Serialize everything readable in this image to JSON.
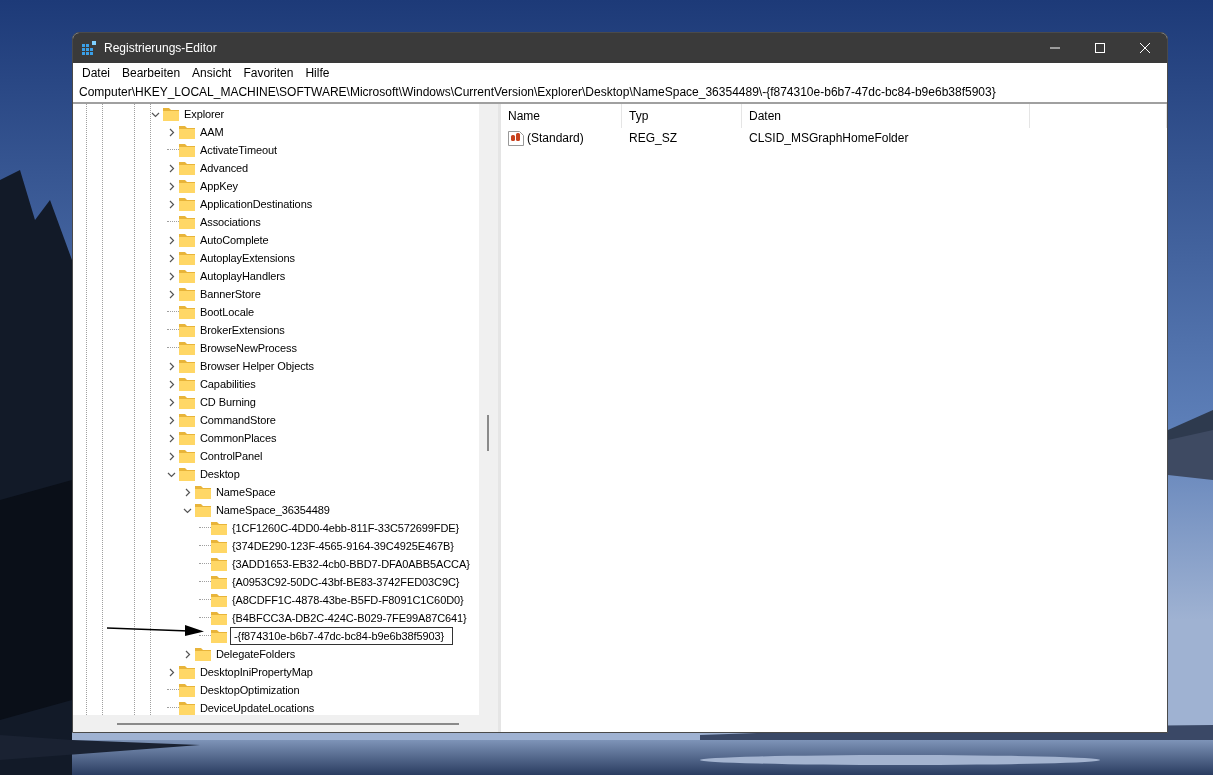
{
  "window": {
    "title": "Registrierungs-Editor"
  },
  "menu": [
    "Datei",
    "Bearbeiten",
    "Ansicht",
    "Favoriten",
    "Hilfe"
  ],
  "address": "Computer\\HKEY_LOCAL_MACHINE\\SOFTWARE\\Microsoft\\Windows\\CurrentVersion\\Explorer\\Desktop\\NameSpace_36354489\\-{f874310e-b6b7-47dc-bc84-b9e6b38f5903}",
  "tree": [
    {
      "label": "Explorer",
      "kind": "expanded",
      "editing": false,
      "children": [
        {
          "label": "AAM",
          "kind": "collapsed",
          "editing": false
        },
        {
          "label": "ActivateTimeout",
          "kind": "leaf",
          "editing": false
        },
        {
          "label": "Advanced",
          "kind": "collapsed",
          "editing": false
        },
        {
          "label": "AppKey",
          "kind": "collapsed",
          "editing": false
        },
        {
          "label": "ApplicationDestinations",
          "kind": "collapsed",
          "editing": false
        },
        {
          "label": "Associations",
          "kind": "leaf",
          "editing": false
        },
        {
          "label": "AutoComplete",
          "kind": "collapsed",
          "editing": false
        },
        {
          "label": "AutoplayExtensions",
          "kind": "collapsed",
          "editing": false
        },
        {
          "label": "AutoplayHandlers",
          "kind": "collapsed",
          "editing": false
        },
        {
          "label": "BannerStore",
          "kind": "collapsed",
          "editing": false
        },
        {
          "label": "BootLocale",
          "kind": "leaf",
          "editing": false
        },
        {
          "label": "BrokerExtensions",
          "kind": "leaf",
          "editing": false
        },
        {
          "label": "BrowseNewProcess",
          "kind": "leaf",
          "editing": false
        },
        {
          "label": "Browser Helper Objects",
          "kind": "collapsed",
          "editing": false
        },
        {
          "label": "Capabilities",
          "kind": "collapsed",
          "editing": false
        },
        {
          "label": "CD Burning",
          "kind": "collapsed",
          "editing": false
        },
        {
          "label": "CommandStore",
          "kind": "collapsed",
          "editing": false
        },
        {
          "label": "CommonPlaces",
          "kind": "collapsed",
          "editing": false
        },
        {
          "label": "ControlPanel",
          "kind": "collapsed",
          "editing": false
        },
        {
          "label": "Desktop",
          "kind": "expanded",
          "editing": false,
          "children": [
            {
              "label": "NameSpace",
              "kind": "collapsed",
              "editing": false
            },
            {
              "label": "NameSpace_36354489",
              "kind": "expanded",
              "editing": false,
              "children": [
                {
                  "label": "{1CF1260C-4DD0-4ebb-811F-33C572699FDE}",
                  "kind": "leaf",
                  "editing": false
                },
                {
                  "label": "{374DE290-123F-4565-9164-39C4925E467B}",
                  "kind": "leaf",
                  "editing": false
                },
                {
                  "label": "{3ADD1653-EB32-4cb0-BBD7-DFA0ABB5ACCA}",
                  "kind": "leaf",
                  "editing": false
                },
                {
                  "label": "{A0953C92-50DC-43bf-BE83-3742FED03C9C}",
                  "kind": "leaf",
                  "editing": false
                },
                {
                  "label": "{A8CDFF1C-4878-43be-B5FD-F8091C1C60D0}",
                  "kind": "leaf",
                  "editing": false
                },
                {
                  "label": "{B4BFCC3A-DB2C-424C-B029-7FE99A87C641}",
                  "kind": "leaf",
                  "editing": false
                },
                {
                  "label": "-{f874310e-b6b7-47dc-bc84-b9e6b38f5903}",
                  "kind": "leaf",
                  "editing": true
                }
              ]
            },
            {
              "label": "DelegateFolders",
              "kind": "collapsed",
              "editing": false
            }
          ]
        },
        {
          "label": "DesktopIniPropertyMap",
          "kind": "collapsed",
          "editing": false
        },
        {
          "label": "DesktopOptimization",
          "kind": "leaf",
          "editing": false
        },
        {
          "label": "DeviceUpdateLocations",
          "kind": "leaf",
          "editing": false
        }
      ]
    }
  ],
  "values": {
    "columns": [
      "Name",
      "Typ",
      "Daten"
    ],
    "rows": [
      {
        "name": "(Standard)",
        "type": "REG_SZ",
        "data": "CLSID_MSGraphHomeFolder"
      }
    ]
  }
}
